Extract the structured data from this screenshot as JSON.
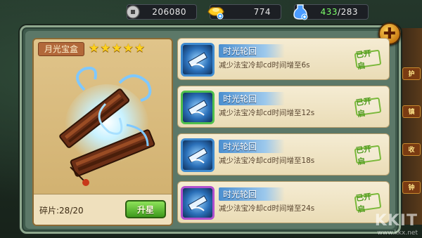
{
  "resources": {
    "silver": {
      "icon": "silver-coin-icon",
      "value": "206080"
    },
    "gold": {
      "icon": "gold-ingot-icon",
      "value": "774"
    },
    "energy": {
      "icon": "energy-potion-icon",
      "current": "433",
      "max": "/283"
    }
  },
  "side_tags": [
    "护",
    "镇",
    "收",
    "钟"
  ],
  "item": {
    "name": "月光宝盒",
    "stars": 5,
    "shards_label": "碎片:28/20",
    "upgrade_label": "升星"
  },
  "skills": [
    {
      "name": "时光轮回",
      "desc": "减少法宝冷却cd时间增至6s",
      "status": "已开启",
      "frame_color": "blue"
    },
    {
      "name": "时光轮回",
      "desc": "减少法宝冷却cd时间增至12s",
      "status": "已开启",
      "frame_color": "green"
    },
    {
      "name": "时光轮回",
      "desc": "减少法宝冷却cd时间增至18s",
      "status": "已开启",
      "frame_color": "blue"
    },
    {
      "name": "时光轮回",
      "desc": "减少法宝冷却cd时间增至24s",
      "status": "已开启",
      "frame_color": "purple"
    }
  ],
  "watermark": {
    "logo": "KKIT",
    "url": "www.kkx.net"
  },
  "colors": {
    "frame": "#3f5a4c",
    "card": "#e0c48a",
    "accent_green": "#4f9a1e",
    "energy_text": "#7cff6a"
  }
}
